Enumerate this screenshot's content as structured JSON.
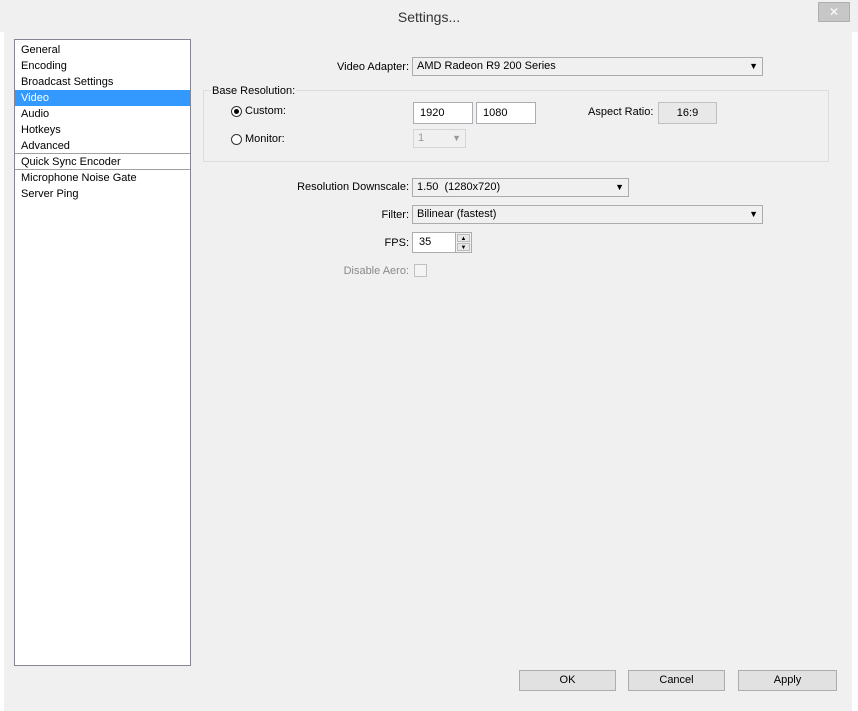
{
  "window": {
    "title": "Settings...",
    "close_glyph": "✕"
  },
  "sidebar": {
    "items": [
      {
        "label": "General"
      },
      {
        "label": "Encoding"
      },
      {
        "label": "Broadcast Settings"
      },
      {
        "label": "Video",
        "selected": true
      },
      {
        "label": "Audio"
      },
      {
        "label": "Hotkeys"
      },
      {
        "label": "Advanced"
      },
      {
        "label": "Quick Sync Encoder"
      },
      {
        "label": "Microphone Noise Gate"
      },
      {
        "label": "Server Ping"
      }
    ]
  },
  "video": {
    "adapter_label": "Video Adapter:",
    "adapter_value": "AMD Radeon R9 200 Series",
    "base_resolution_label": "Base Resolution:",
    "custom_label": "Custom:",
    "custom_selected": true,
    "width": "1920",
    "height": "1080",
    "aspect_label": "Aspect Ratio:",
    "aspect_value": "16:9",
    "monitor_label": "Monitor:",
    "monitor_value": "1",
    "downscale_label": "Resolution Downscale:",
    "downscale_value": "1.50  (1280x720)",
    "filter_label": "Filter:",
    "filter_value": "Bilinear (fastest)",
    "fps_label": "FPS:",
    "fps_value": "35",
    "aero_label": "Disable Aero:",
    "aero_checked": false
  },
  "buttons": {
    "ok": "OK",
    "cancel": "Cancel",
    "apply": "Apply"
  },
  "icons": {
    "dropdown": "chevron-down-icon",
    "spin_up": "spin-up-icon",
    "spin_down": "spin-down-icon"
  }
}
